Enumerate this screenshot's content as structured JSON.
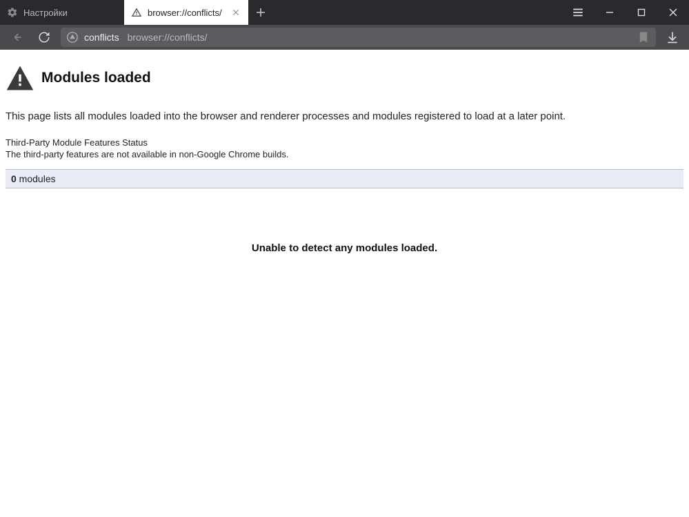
{
  "tabs": [
    {
      "label": "Настройки",
      "active": false
    },
    {
      "label": "browser://conflicts/",
      "active": true
    }
  ],
  "address": {
    "site_name": "conflicts",
    "url": "browser://conflicts/"
  },
  "page": {
    "title": "Modules loaded",
    "description": "This page lists all modules loaded into the browser and renderer processes and modules registered to load at a later point.",
    "features_title": "Third-Party Module Features Status",
    "features_desc": "The third-party features are not available in non-Google Chrome builds.",
    "modules_count": "0",
    "modules_label": " modules",
    "empty_message": "Unable to detect any modules loaded."
  }
}
